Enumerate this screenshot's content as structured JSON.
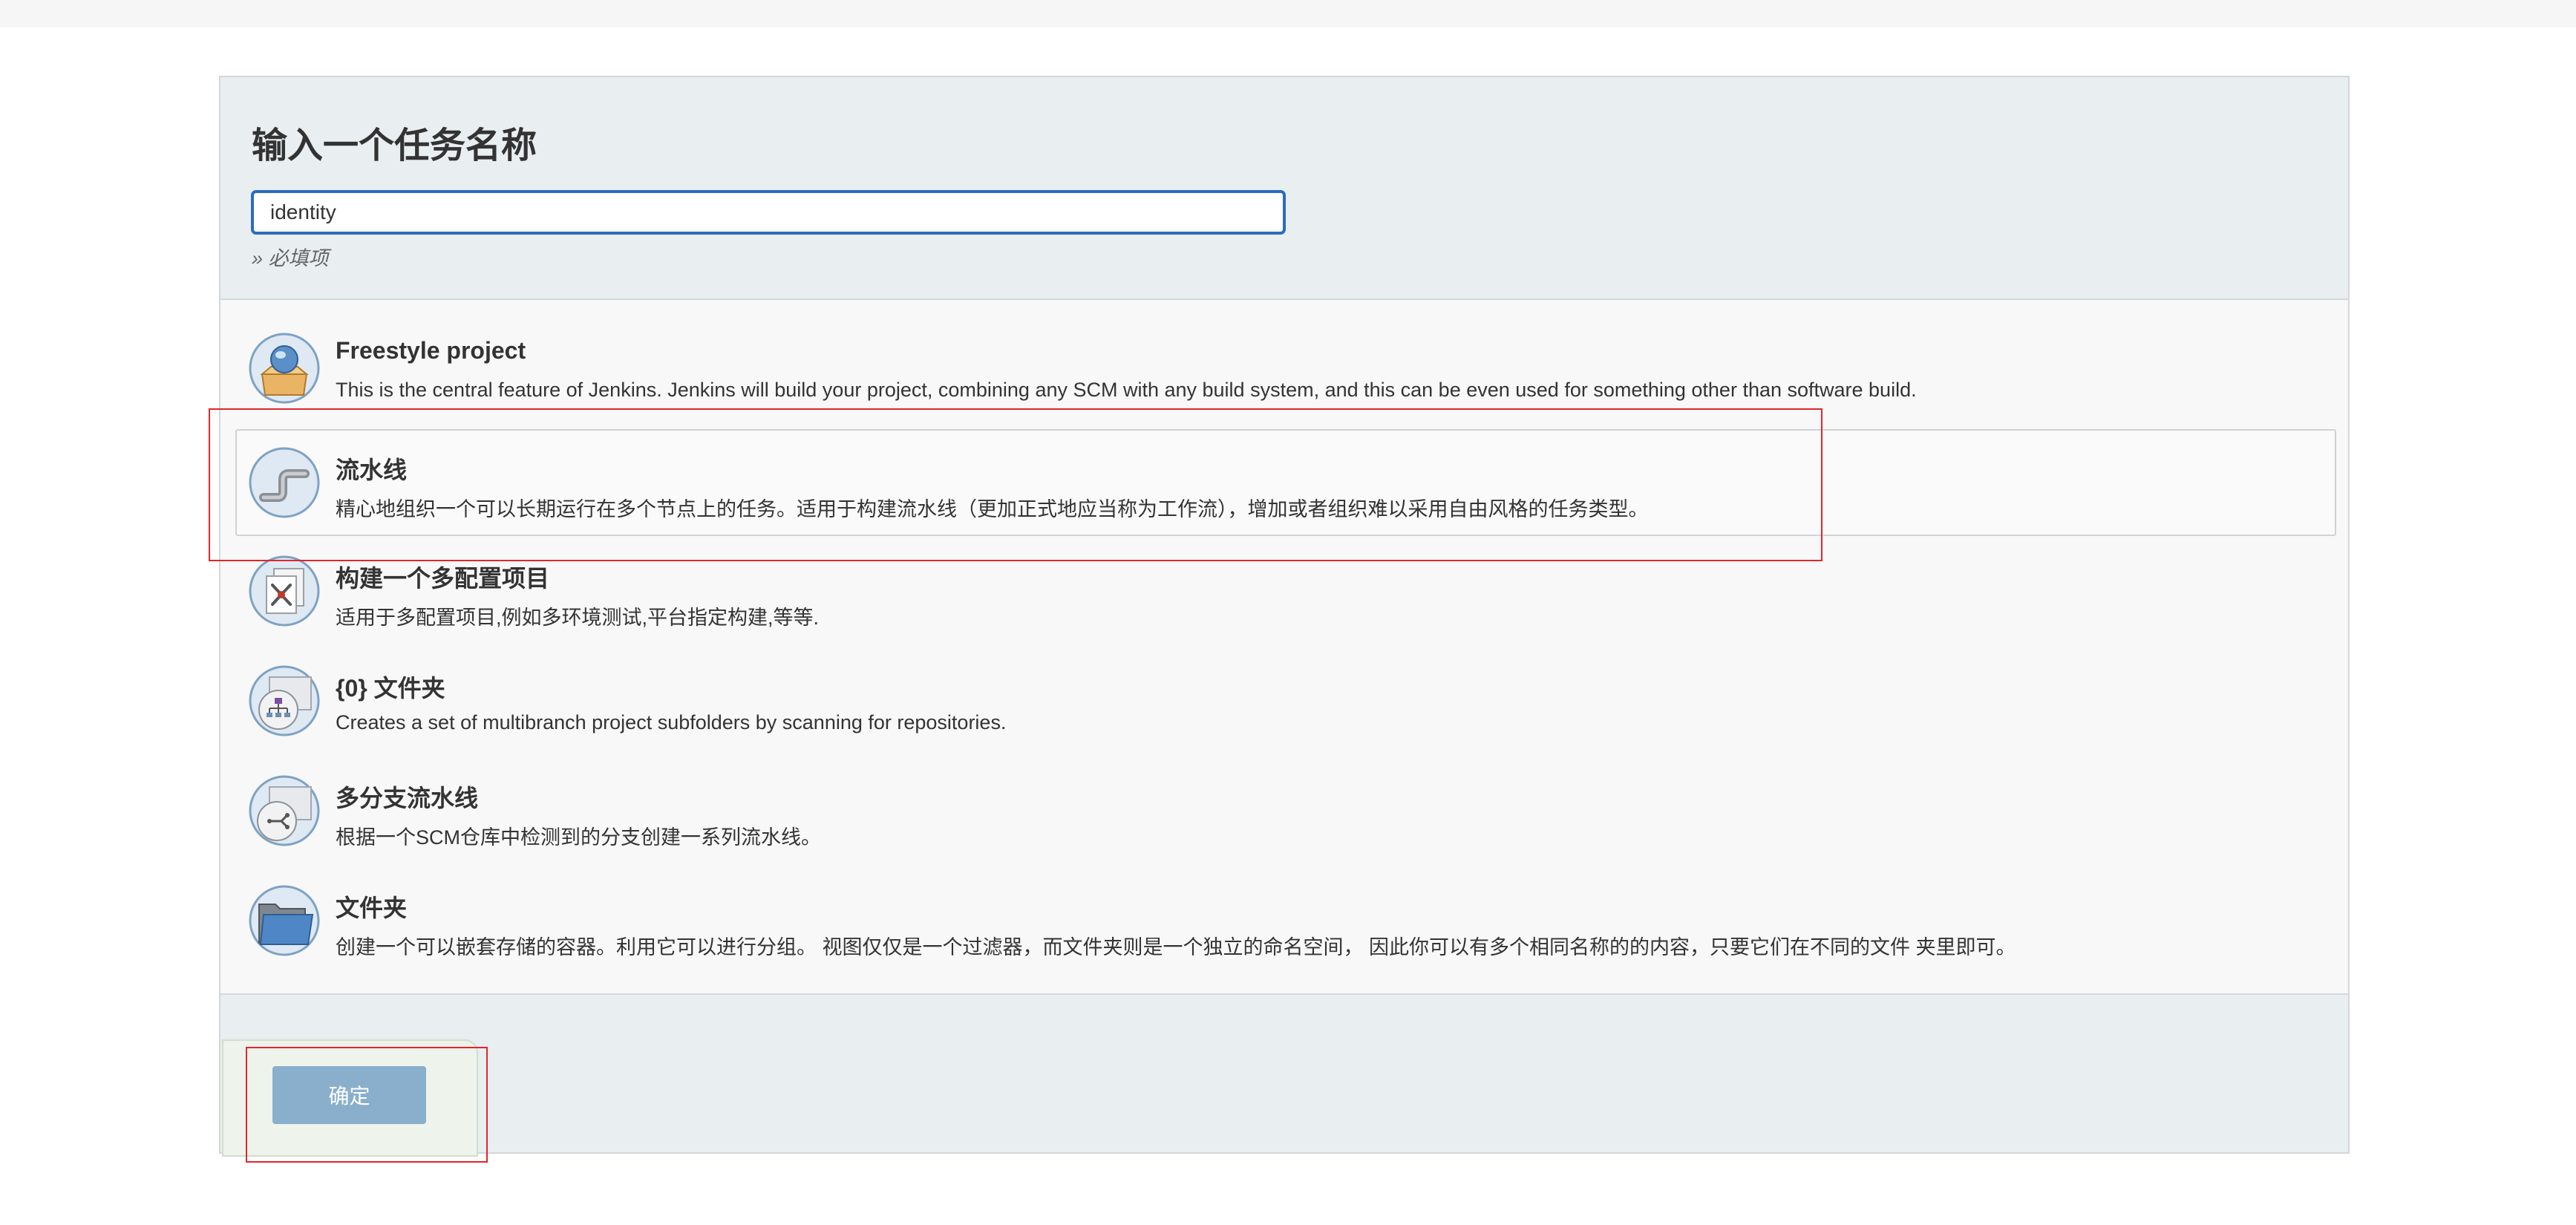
{
  "form": {
    "title": "输入一个任务名称",
    "name_value": "identity",
    "required_hint": "» 必填项"
  },
  "job_types": [
    {
      "icon": "freestyle-project-icon",
      "name": "Freestyle project",
      "description": "This is the central feature of Jenkins. Jenkins will build your project, combining any SCM with any build system, and this can be even used for something other than software build."
    },
    {
      "icon": "pipeline-icon",
      "name": "流水线",
      "description": "精心地组织一个可以长期运行在多个节点上的任务。适用于构建流水线（更加正式地应当称为工作流），增加或者组织难以采用自由风格的任务类型。",
      "selected": true
    },
    {
      "icon": "multi-configuration-icon",
      "name": "构建一个多配置项目",
      "description": "适用于多配置项目,例如多环境测试,平台指定构建,等等."
    },
    {
      "icon": "organization-folder-icon",
      "name": "{0} 文件夹",
      "description": "Creates a set of multibranch project subfolders by scanning for repositories."
    },
    {
      "icon": "multibranch-pipeline-icon",
      "name": "多分支流水线",
      "description": "根据一个SCM仓库中检测到的分支创建一系列流水线。"
    },
    {
      "icon": "folder-icon",
      "name": "文件夹",
      "description": "创建一个可以嵌套存储的容器。利用它可以进行分组。 视图仅仅是一个过滤器，而文件夹则是一个独立的命名空间， 因此你可以有多个相同名称的的内容，只要它们在不同的文件 夹里即可。"
    }
  ],
  "footer": {
    "ok_label": "确定"
  },
  "colors": {
    "accent": "#2d6bc2",
    "button": "#89afcc",
    "highlight": "#e0262c"
  }
}
